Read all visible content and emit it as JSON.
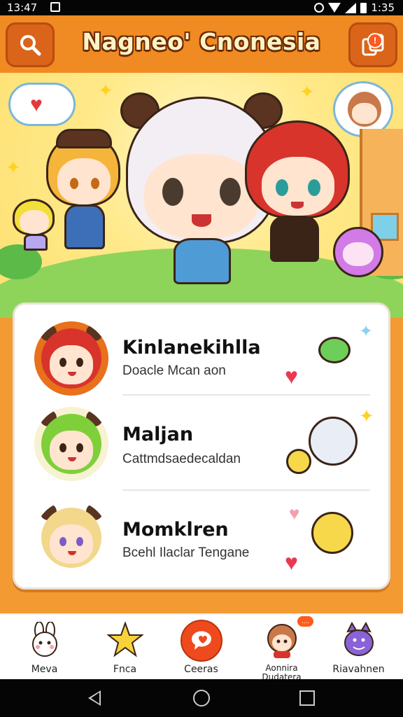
{
  "status_bar": {
    "time_left": "13:47",
    "time_right": "1:35"
  },
  "header": {
    "title": "Nagneo' Cnonesia",
    "notification_badge": "!"
  },
  "chats": [
    {
      "name": "Kinlanekihlla",
      "preview": "Doacle Mcan aon",
      "hair_color": "#d8342c",
      "ring_color": "#e8711c"
    },
    {
      "name": "Maljan",
      "preview": "Cattmdsaedecaldan",
      "hair_color": "#7fcf3a",
      "ring_color": "#f7f2d2"
    },
    {
      "name": "Momklren",
      "preview": "Bcehl Ilaclar Tengane",
      "hair_color": "#f3d78a",
      "ring_color": "#ffffff"
    }
  ],
  "nav": [
    {
      "label": "Meva",
      "icon": "bunny-icon"
    },
    {
      "label": "Fnca",
      "icon": "star-icon"
    },
    {
      "label": "Ceeras",
      "icon": "chat-bubble-icon"
    },
    {
      "label": "Aonnira Dudatera",
      "icon": "character-icon",
      "badge": "...."
    },
    {
      "label": "Riavahnen",
      "icon": "monster-icon"
    }
  ],
  "colors": {
    "accent": "#f08a22",
    "header_button": "#d9641a",
    "heart": "#e83a52"
  }
}
